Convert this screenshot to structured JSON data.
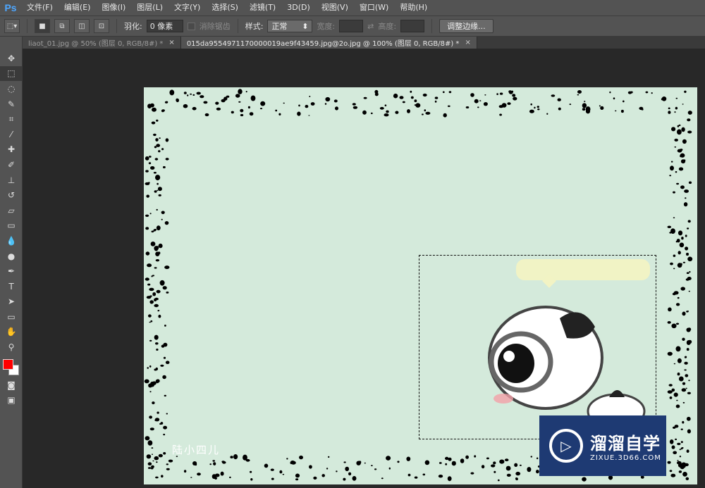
{
  "app": {
    "logo": "Ps"
  },
  "menu": [
    "文件(F)",
    "编辑(E)",
    "图像(I)",
    "图层(L)",
    "文字(Y)",
    "选择(S)",
    "滤镜(T)",
    "3D(D)",
    "视图(V)",
    "窗口(W)",
    "帮助(H)"
  ],
  "options": {
    "feather_label": "羽化:",
    "feather_value": "0 像素",
    "antialias_label": "消除锯齿",
    "style_label": "样式:",
    "style_value": "正常",
    "width_label": "宽度:",
    "height_label": "高度:",
    "refine_button": "调整边缘..."
  },
  "tabs": [
    {
      "title": "liaot_01.jpg @ 50% (图层 0, RGB/8#) *",
      "close": "×",
      "active": false
    },
    {
      "title": "015da9554971170000019ae9f43459.jpg@2o.jpg @ 100% (图层 0, RGB/8#) *",
      "close": "×",
      "active": true
    }
  ],
  "toolbox": {
    "tools": [
      "move-icon",
      "marquee-icon",
      "lasso-icon",
      "quick-select-icon",
      "crop-icon",
      "eyedropper-icon",
      "healing-icon",
      "brush-icon",
      "stamp-icon",
      "history-brush-icon",
      "eraser-icon",
      "gradient-icon",
      "blur-icon",
      "dodge-icon",
      "pen-icon",
      "type-icon",
      "path-select-icon",
      "shape-icon",
      "hand-icon",
      "zoom-icon"
    ],
    "foreground_color": "#ff0000",
    "background_color": "#ffffff"
  },
  "canvas": {
    "background_color": "#d4eadb",
    "credit_text": "陆小四儿"
  },
  "watermark": {
    "title": "溜溜自学",
    "subtitle": "ZIXUE.3D66.COM"
  }
}
